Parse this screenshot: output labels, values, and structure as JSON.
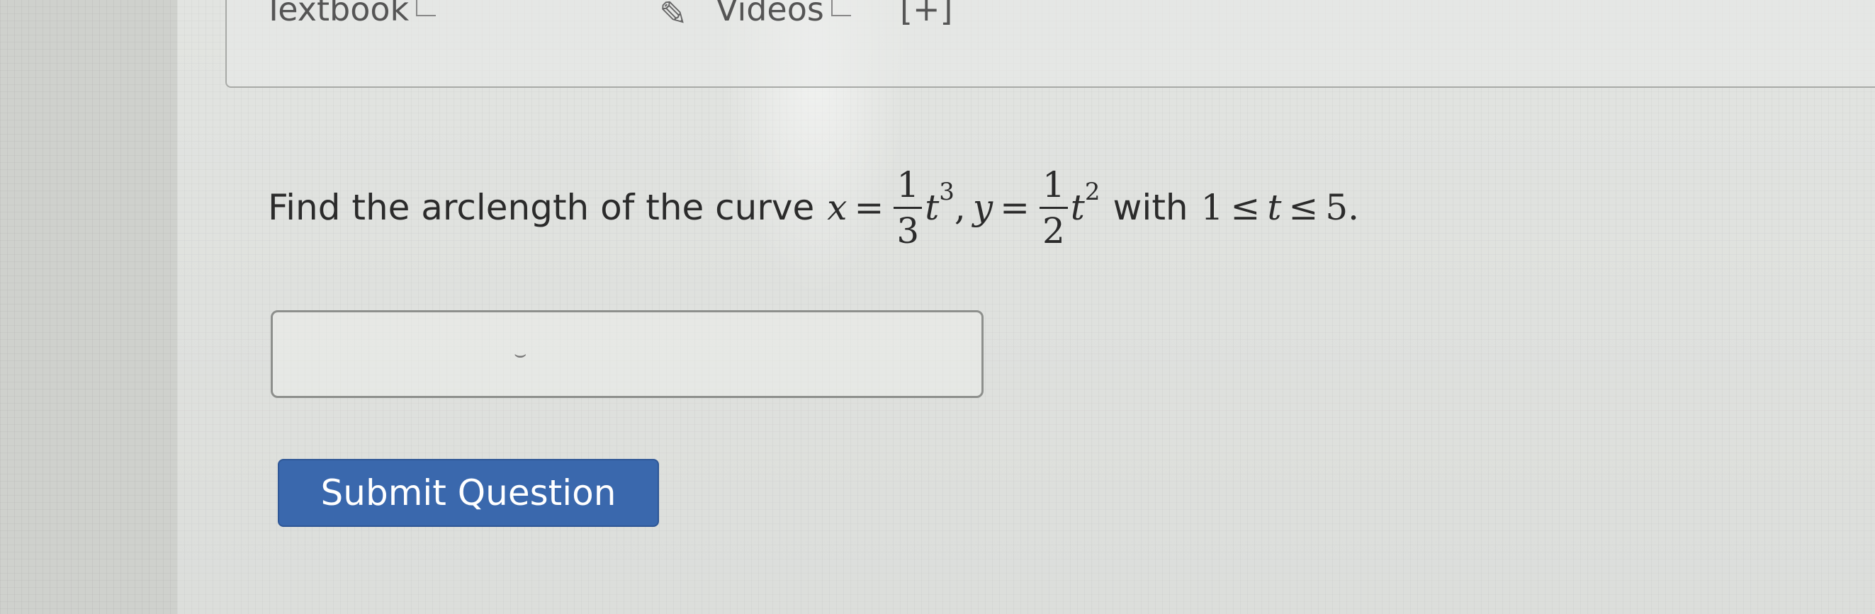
{
  "resources": {
    "textbook_label": "Textbook",
    "videos_label": "Videos",
    "add_label": "[+]"
  },
  "question": {
    "prefix": "Find the arclength of the curve",
    "x_var": "x",
    "equals": "=",
    "frac1_num": "1",
    "frac1_den": "3",
    "t_var": "t",
    "exp1": "3",
    "comma": ",",
    "y_var": "y",
    "frac2_num": "1",
    "frac2_den": "2",
    "exp2": "2",
    "with_text": "with",
    "lower": "1",
    "leq": "≤",
    "upper": "5",
    "period": "."
  },
  "answer": {
    "value": ""
  },
  "submit": {
    "label": "Submit Question"
  },
  "colors": {
    "button_bg": "#3a68ad",
    "button_text": "#ffffff",
    "page_bg": "#dcdedb"
  }
}
